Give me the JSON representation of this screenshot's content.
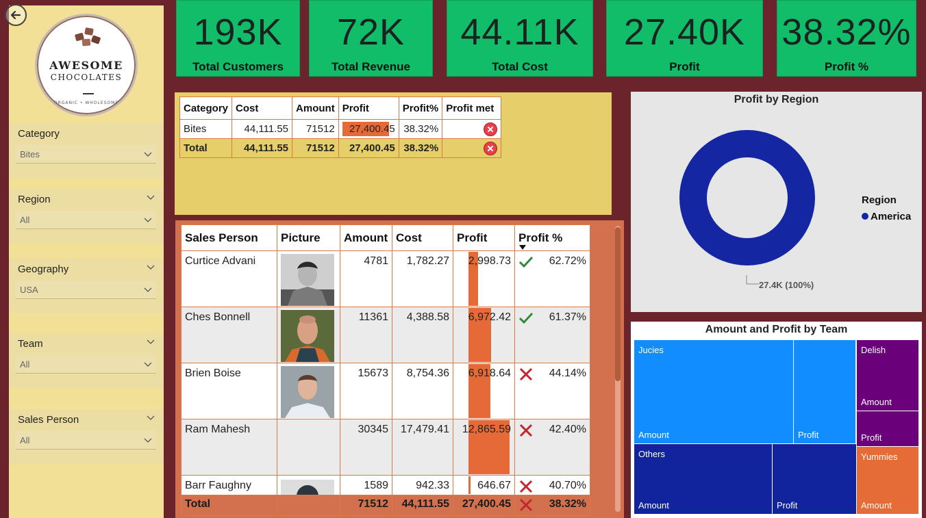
{
  "kpis": [
    {
      "value": "193K",
      "label": "Total Customers"
    },
    {
      "value": "72K",
      "label": "Total Revenue"
    },
    {
      "value": "44.11K",
      "label": "Total Cost"
    },
    {
      "value": "27.40K",
      "label": "Profit"
    },
    {
      "value": "38.32%",
      "label": "Profit %"
    }
  ],
  "logo": {
    "line1": "AWESOME",
    "line2": "CHOCOLATES",
    "tagline": "ORGANIC • WHOLESOME"
  },
  "slicers": [
    {
      "title": "Category",
      "value": "Bites"
    },
    {
      "title": "Region",
      "value": "All"
    },
    {
      "title": "Geography",
      "value": "USA"
    },
    {
      "title": "Team",
      "value": "All"
    },
    {
      "title": "Sales Person",
      "value": "All"
    }
  ],
  "category_table": {
    "headers": [
      "Category",
      "Cost",
      "Amount",
      "Profit",
      "Profit%",
      "Profit met"
    ],
    "rows": [
      {
        "category": "Bites",
        "cost": "44,111.55",
        "amount": "71512",
        "profit": "27,400.45",
        "profit_pct": "38.32%",
        "profit_met": false,
        "profit_fraction": 0.95
      }
    ],
    "total": {
      "category": "Total",
      "cost": "44,111.55",
      "amount": "71512",
      "profit": "27,400.45",
      "profit_pct": "38.32%",
      "profit_met": false
    }
  },
  "sales_table": {
    "headers": [
      "Sales Person",
      "Picture",
      "Amount",
      "Cost",
      "Profit",
      "Profit %"
    ],
    "rows": [
      {
        "name": "Curtice Advani",
        "amount": "4781",
        "cost": "1,782.27",
        "profit": "2,998.73",
        "profit_pct": "62.72%",
        "met": true,
        "profit_fraction": 0.233,
        "has_picture": true
      },
      {
        "name": "Ches Bonnell",
        "amount": "11361",
        "cost": "4,388.58",
        "profit": "6,972.42",
        "profit_pct": "61.37%",
        "met": true,
        "profit_fraction": 0.542,
        "has_picture": true
      },
      {
        "name": "Brien Boise",
        "amount": "15673",
        "cost": "8,754.36",
        "profit": "6,918.64",
        "profit_pct": "44.14%",
        "met": false,
        "profit_fraction": 0.538,
        "has_picture": true
      },
      {
        "name": "Ram Mahesh",
        "amount": "30345",
        "cost": "17,479.41",
        "profit": "12,865.59",
        "profit_pct": "42.40%",
        "met": false,
        "profit_fraction": 1.0,
        "has_picture": false
      },
      {
        "name": "Barr Faughny",
        "amount": "1589",
        "cost": "942.33",
        "profit": "646.67",
        "profit_pct": "40.70%",
        "met": false,
        "profit_fraction": 0.05,
        "has_picture": true
      }
    ],
    "total": {
      "name": "Total",
      "amount": "71512",
      "cost": "44,111.55",
      "profit": "27,400.45",
      "profit_pct": "38.32%",
      "met": false
    }
  },
  "donut": {
    "title": "Profit by Region",
    "legend_title": "Region",
    "legend_item": "America",
    "label": "27.4K (100%)",
    "color": "#1526a3"
  },
  "treemap": {
    "title": "Amount and Profit by Team",
    "cells": [
      {
        "team": "Jucies",
        "amount_label": "Amount",
        "profit_label": "Profit",
        "color": "#118dff"
      },
      {
        "team": "Delish",
        "amount_label": "Amount",
        "profit_label": "Profit",
        "color": "#6b007b"
      },
      {
        "team": "Others",
        "amount_label": "Amount",
        "profit_label": "Profit",
        "color": "#12239e"
      },
      {
        "team": "Yummies",
        "amount_label": "Amount",
        "color": "#e66c37"
      }
    ]
  }
}
